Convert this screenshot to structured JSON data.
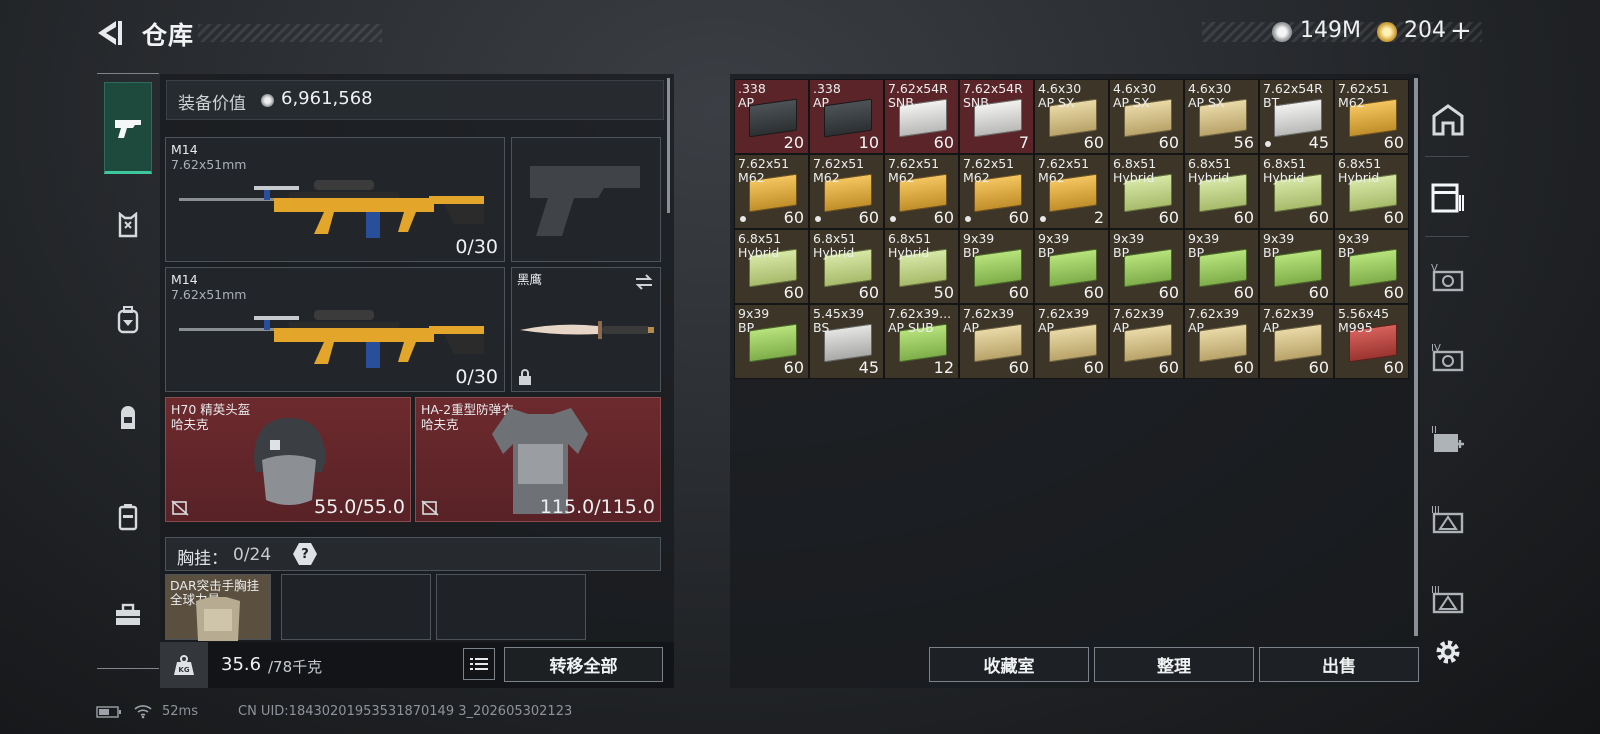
{
  "header": {
    "title": "仓库",
    "currency1_value": "149M",
    "currency2_value": "204",
    "currency2_plus": "+"
  },
  "equipment": {
    "value_label": "装备价值",
    "value": "6,961,568",
    "primary1": {
      "name": "M14",
      "caliber": "7.62x51mm",
      "ammo": "0/30"
    },
    "primary2": {
      "name": "M14",
      "caliber": "7.62x51mm",
      "ammo": "0/30"
    },
    "melee": {
      "name": "黑鹰"
    },
    "helmet": {
      "name": "H70 精英头盔",
      "brand": "哈夫克",
      "durability": "55.0/55.0"
    },
    "armor": {
      "name": "HA-2重型防弹衣",
      "brand": "哈夫克",
      "durability": "115.0/115.0"
    },
    "chest_rig": {
      "label": "胸挂：",
      "capacity": "0/24",
      "help": "?",
      "item_name": "DAR突击手胸挂",
      "item_brand": "全球力量"
    },
    "weight": "35.6",
    "weight_max": "/78千克",
    "transfer_all": "转移全部"
  },
  "items": [
    {
      "l1": ".338",
      "l2": "AP",
      "qty": "20",
      "box": "b-dark",
      "red": true
    },
    {
      "l1": ".338",
      "l2": "AP",
      "qty": "10",
      "box": "b-dark",
      "red": true
    },
    {
      "l1": "7.62x54R",
      "l2": "SNB",
      "qty": "60",
      "box": "b-white",
      "red": true
    },
    {
      "l1": "7.62x54R",
      "l2": "SNB",
      "qty": "7",
      "box": "b-white",
      "red": true
    },
    {
      "l1": "4.6x30",
      "l2": "AP SX",
      "qty": "60",
      "box": "b-tan"
    },
    {
      "l1": "4.6x30",
      "l2": "AP SX",
      "qty": "60",
      "box": "b-tan"
    },
    {
      "l1": "4.6x30",
      "l2": "AP SX",
      "qty": "56",
      "box": "b-tan"
    },
    {
      "l1": "7.62x54R",
      "l2": "BT",
      "qty": "45",
      "box": "b-white",
      "dot": true
    },
    {
      "l1": "7.62x51",
      "l2": "M62",
      "qty": "60",
      "box": "b-yellow"
    },
    {
      "l1": "7.62x51",
      "l2": "M62",
      "qty": "60",
      "box": "b-yellow",
      "dot": true
    },
    {
      "l1": "7.62x51",
      "l2": "M62",
      "qty": "60",
      "box": "b-yellow",
      "dot": true
    },
    {
      "l1": "7.62x51",
      "l2": "M62",
      "qty": "60",
      "box": "b-yellow",
      "dot": true
    },
    {
      "l1": "7.62x51",
      "l2": "M62",
      "qty": "60",
      "box": "b-yellow",
      "dot": true
    },
    {
      "l1": "7.62x51",
      "l2": "M62",
      "qty": "2",
      "box": "b-yellow",
      "dot": true
    },
    {
      "l1": "6.8x51",
      "l2": "Hybrid",
      "qty": "60",
      "box": "b-lgreen"
    },
    {
      "l1": "6.8x51",
      "l2": "Hybrid",
      "qty": "60",
      "box": "b-lgreen"
    },
    {
      "l1": "6.8x51",
      "l2": "Hybrid",
      "qty": "60",
      "box": "b-lgreen"
    },
    {
      "l1": "6.8x51",
      "l2": "Hybrid",
      "qty": "60",
      "box": "b-lgreen"
    },
    {
      "l1": "6.8x51",
      "l2": "Hybrid",
      "qty": "60",
      "box": "b-lgreen"
    },
    {
      "l1": "6.8x51",
      "l2": "Hybrid",
      "qty": "60",
      "box": "b-lgreen"
    },
    {
      "l1": "6.8x51",
      "l2": "Hybrid",
      "qty": "50",
      "box": "b-lgreen"
    },
    {
      "l1": "9x39",
      "l2": "BP",
      "qty": "60",
      "box": "b-green"
    },
    {
      "l1": "9x39",
      "l2": "BP",
      "qty": "60",
      "box": "b-green"
    },
    {
      "l1": "9x39",
      "l2": "BP",
      "qty": "60",
      "box": "b-green"
    },
    {
      "l1": "9x39",
      "l2": "BP",
      "qty": "60",
      "box": "b-green"
    },
    {
      "l1": "9x39",
      "l2": "BP",
      "qty": "60",
      "box": "b-green"
    },
    {
      "l1": "9x39",
      "l2": "BP",
      "qty": "60",
      "box": "b-green"
    },
    {
      "l1": "9x39",
      "l2": "BP",
      "qty": "60",
      "box": "b-green"
    },
    {
      "l1": "5.45x39",
      "l2": "BS",
      "qty": "45",
      "box": "b-gray"
    },
    {
      "l1": "7.62x39...",
      "l2": "AP SUB",
      "qty": "12",
      "box": "b-green"
    },
    {
      "l1": "7.62x39",
      "l2": "AP",
      "qty": "60",
      "box": "b-tan"
    },
    {
      "l1": "7.62x39",
      "l2": "AP",
      "qty": "60",
      "box": "b-tan"
    },
    {
      "l1": "7.62x39",
      "l2": "AP",
      "qty": "60",
      "box": "b-tan"
    },
    {
      "l1": "7.62x39",
      "l2": "AP",
      "qty": "60",
      "box": "b-tan"
    },
    {
      "l1": "7.62x39",
      "l2": "AP",
      "qty": "60",
      "box": "b-tan"
    },
    {
      "l1": "5.56x45",
      "l2": "M995",
      "qty": "60",
      "box": "b-red"
    }
  ],
  "actions": {
    "collection": "收藏室",
    "sort": "整理",
    "sell": "出售"
  },
  "status": {
    "ping": "52ms",
    "uid": "CN UID:18430201953531870149 3_202605302123"
  },
  "colors": {
    "accent_green": "#3fc79b",
    "red_slot": "#6d2a2e"
  }
}
